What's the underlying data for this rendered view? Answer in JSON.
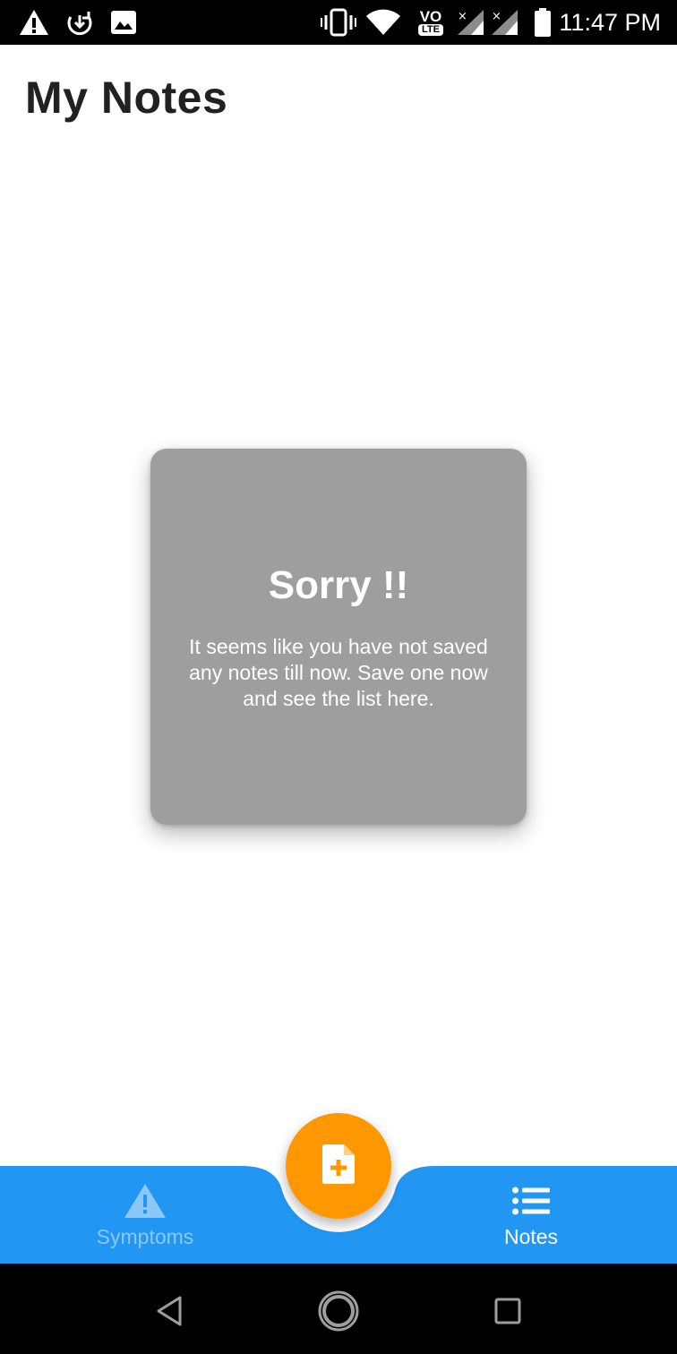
{
  "status_bar": {
    "time": "11:47 PM",
    "network_badge_top": "VO",
    "network_badge_bottom": "LTE",
    "left_icons": [
      "warning-icon",
      "download-sync-icon",
      "image-icon"
    ],
    "right_icons": [
      "vibrate-icon",
      "wifi-icon",
      "volte-icon",
      "signal-icon",
      "signal-icon",
      "battery-icon"
    ]
  },
  "header": {
    "title": "My Notes"
  },
  "empty_state": {
    "title": "Sorry !!",
    "message": "It seems like you have not saved any notes till now. Save one now and see the list here."
  },
  "fab": {
    "icon": "note-add-icon",
    "color": "#ff9800"
  },
  "bottom_nav": {
    "background": "#2196f3",
    "items": [
      {
        "label": "Symptoms",
        "icon": "warning-triangle-icon",
        "active": false
      },
      {
        "label": "Notes",
        "icon": "list-icon",
        "active": true
      }
    ]
  },
  "system_nav": {
    "buttons": [
      "back-icon",
      "home-icon",
      "recents-icon"
    ]
  },
  "colors": {
    "card": "#9e9e9e",
    "title_text": "#212121",
    "inactive_nav": "#8cc8f7"
  }
}
